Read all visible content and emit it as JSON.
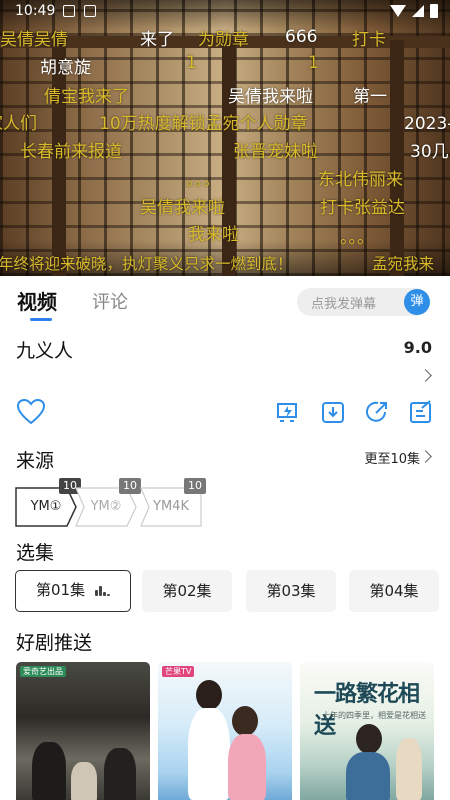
{
  "status": {
    "time": "10:49"
  },
  "danmaku": [
    {
      "text": "吴倩吴倩",
      "color": "y"
    },
    {
      "text": "来了",
      "color": "w"
    },
    {
      "text": "为勋章",
      "color": "y"
    },
    {
      "text": "666",
      "color": "w"
    },
    {
      "text": "打卡",
      "color": "y"
    },
    {
      "text": "胡意旋",
      "color": "w"
    },
    {
      "text": "1",
      "color": "y"
    },
    {
      "text": "1",
      "color": "y"
    },
    {
      "text": "倩宝我来了",
      "color": "y"
    },
    {
      "text": "吴倩我来啦",
      "color": "w"
    },
    {
      "text": "第一",
      "color": "w"
    },
    {
      "text": "家人们",
      "color": "y"
    },
    {
      "text": "10万热度解锁孟宛个人勋章",
      "color": "y"
    },
    {
      "text": "2023-",
      "color": "w"
    },
    {
      "text": "长春前来报道",
      "color": "y"
    },
    {
      "text": "张晋宠妹啦",
      "color": "y"
    },
    {
      "text": "30几",
      "color": "w"
    },
    {
      "text": "。。。",
      "color": "y"
    },
    {
      "text": "东北伟丽来",
      "color": "y"
    },
    {
      "text": "吴倩我来啦",
      "color": "y"
    },
    {
      "text": "打卡张益达",
      "color": "y"
    },
    {
      "text": "我来啦",
      "color": "y"
    },
    {
      "text": "。。。",
      "color": "y"
    },
    {
      "text": "年终将迎来破晓，执灯聚义只求一燃到底！",
      "color": "y"
    },
    {
      "text": "孟宛我来",
      "color": "y"
    }
  ],
  "tabs": {
    "video": "视频",
    "comment": "评论"
  },
  "danmu_input": {
    "placeholder": "点我发弹幕",
    "button": "弹"
  },
  "show": {
    "title": "九义人",
    "score": "9.0"
  },
  "source": {
    "heading": "来源",
    "more": "更至10集",
    "items": [
      {
        "label": "YM①",
        "badge": "10",
        "selected": true
      },
      {
        "label": "YM②",
        "badge": "10",
        "selected": false
      },
      {
        "label": "YM4K",
        "badge": "10",
        "selected": false
      }
    ]
  },
  "episodes": {
    "heading": "选集",
    "items": [
      "第01集",
      "第02集",
      "第03集",
      "第04集"
    ],
    "active_index": 0
  },
  "recommend": {
    "heading": "好剧推送",
    "posters": [
      {
        "badge": "爱奇艺出品"
      },
      {
        "badge": "芒果TV"
      },
      {
        "title": "一路繁花相送",
        "subtitle": "十年的四季里，相爱是花相送"
      }
    ]
  }
}
